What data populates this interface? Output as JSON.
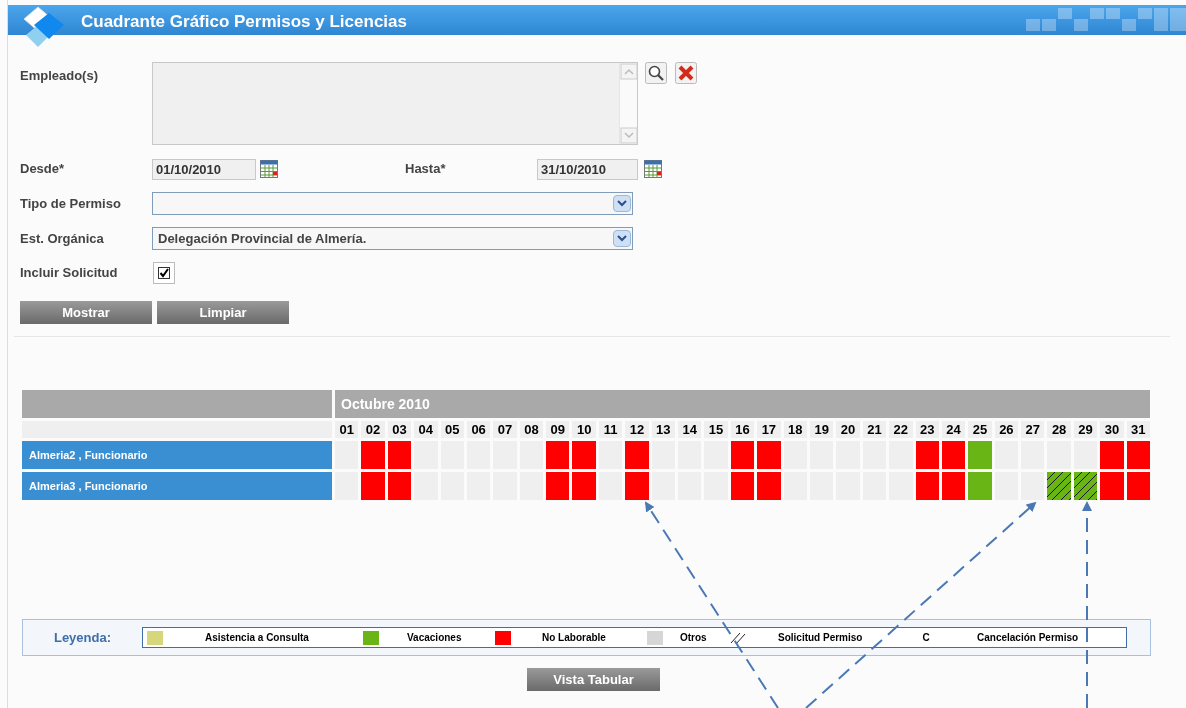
{
  "window": {
    "title": "Cuadrante Gráfico Permisos y Licencias"
  },
  "form": {
    "employees": {
      "label": "Empleado(s)"
    },
    "desde": {
      "label": "Desde*",
      "value": "01/10/2010"
    },
    "hasta": {
      "label": "Hasta*",
      "value": "31/10/2010"
    },
    "tipo_permiso": {
      "label": "Tipo de Permiso"
    },
    "est_organica": {
      "label": "Est. Orgánica",
      "value": "Delegación Provincial de Almería."
    },
    "incluir_solicitud": {
      "label": "Incluir Solicitud",
      "checked": true
    },
    "buttons": [
      "Mostrar",
      "Limpiar"
    ]
  },
  "calendar": {
    "month": "Octubre 2010",
    "days": [
      "01",
      "02",
      "03",
      "04",
      "05",
      "06",
      "07",
      "08",
      "09",
      "10",
      "11",
      "12",
      "13",
      "14",
      "15",
      "16",
      "17",
      "18",
      "19",
      "20",
      "21",
      "22",
      "23",
      "24",
      "25",
      "26",
      "27",
      "28",
      "29",
      "30",
      "31"
    ],
    "rows": [
      {
        "name": "Almeria2 , Funcionario",
        "cells": [
          {
            "kind": "empty"
          },
          {
            "kind": "no_laborable"
          },
          {
            "kind": "no_laborable"
          },
          {
            "kind": "empty"
          },
          {
            "kind": "empty"
          },
          {
            "kind": "empty"
          },
          {
            "kind": "empty"
          },
          {
            "kind": "empty"
          },
          {
            "kind": "no_laborable"
          },
          {
            "kind": "no_laborable"
          },
          {
            "kind": "empty"
          },
          {
            "kind": "no_laborable"
          },
          {
            "kind": "empty"
          },
          {
            "kind": "empty"
          },
          {
            "kind": "empty"
          },
          {
            "kind": "no_laborable"
          },
          {
            "kind": "no_laborable"
          },
          {
            "kind": "empty"
          },
          {
            "kind": "empty"
          },
          {
            "kind": "empty"
          },
          {
            "kind": "empty"
          },
          {
            "kind": "empty"
          },
          {
            "kind": "no_laborable"
          },
          {
            "kind": "no_laborable"
          },
          {
            "kind": "vacaciones"
          },
          {
            "kind": "empty"
          },
          {
            "kind": "empty"
          },
          {
            "kind": "empty"
          },
          {
            "kind": "empty"
          },
          {
            "kind": "no_laborable"
          },
          {
            "kind": "no_laborable"
          }
        ]
      },
      {
        "name": "Almeria3 , Funcionario",
        "cells": [
          {
            "kind": "empty"
          },
          {
            "kind": "no_laborable"
          },
          {
            "kind": "no_laborable"
          },
          {
            "kind": "empty"
          },
          {
            "kind": "empty"
          },
          {
            "kind": "empty"
          },
          {
            "kind": "empty"
          },
          {
            "kind": "empty"
          },
          {
            "kind": "no_laborable"
          },
          {
            "kind": "no_laborable"
          },
          {
            "kind": "empty"
          },
          {
            "kind": "no_laborable"
          },
          {
            "kind": "empty"
          },
          {
            "kind": "empty"
          },
          {
            "kind": "empty"
          },
          {
            "kind": "no_laborable"
          },
          {
            "kind": "no_laborable"
          },
          {
            "kind": "empty"
          },
          {
            "kind": "empty"
          },
          {
            "kind": "empty"
          },
          {
            "kind": "empty"
          },
          {
            "kind": "empty"
          },
          {
            "kind": "no_laborable"
          },
          {
            "kind": "no_laborable"
          },
          {
            "kind": "vacaciones"
          },
          {
            "kind": "empty"
          },
          {
            "kind": "empty"
          },
          {
            "kind": "solicitud"
          },
          {
            "kind": "solicitud"
          },
          {
            "kind": "no_laborable"
          },
          {
            "kind": "no_laborable"
          }
        ]
      }
    ]
  },
  "legend": {
    "title": "Leyenda:",
    "items": [
      {
        "kind": "swatch",
        "color": "#d6d67a",
        "label": "Asistencia a Consulta"
      },
      {
        "kind": "swatch",
        "color": "#6ab516",
        "label": "Vacaciones"
      },
      {
        "kind": "swatch",
        "color": "#ff0000",
        "label": "No Laborable"
      },
      {
        "kind": "swatch",
        "color": "#d6d6d6",
        "label": "Otros"
      },
      {
        "kind": "hatch",
        "label": "Solicitud Permiso"
      },
      {
        "kind": "letter",
        "symbol": "C",
        "label": "Cancelación Permiso"
      }
    ]
  },
  "footer_button": "Vista Tabular"
}
